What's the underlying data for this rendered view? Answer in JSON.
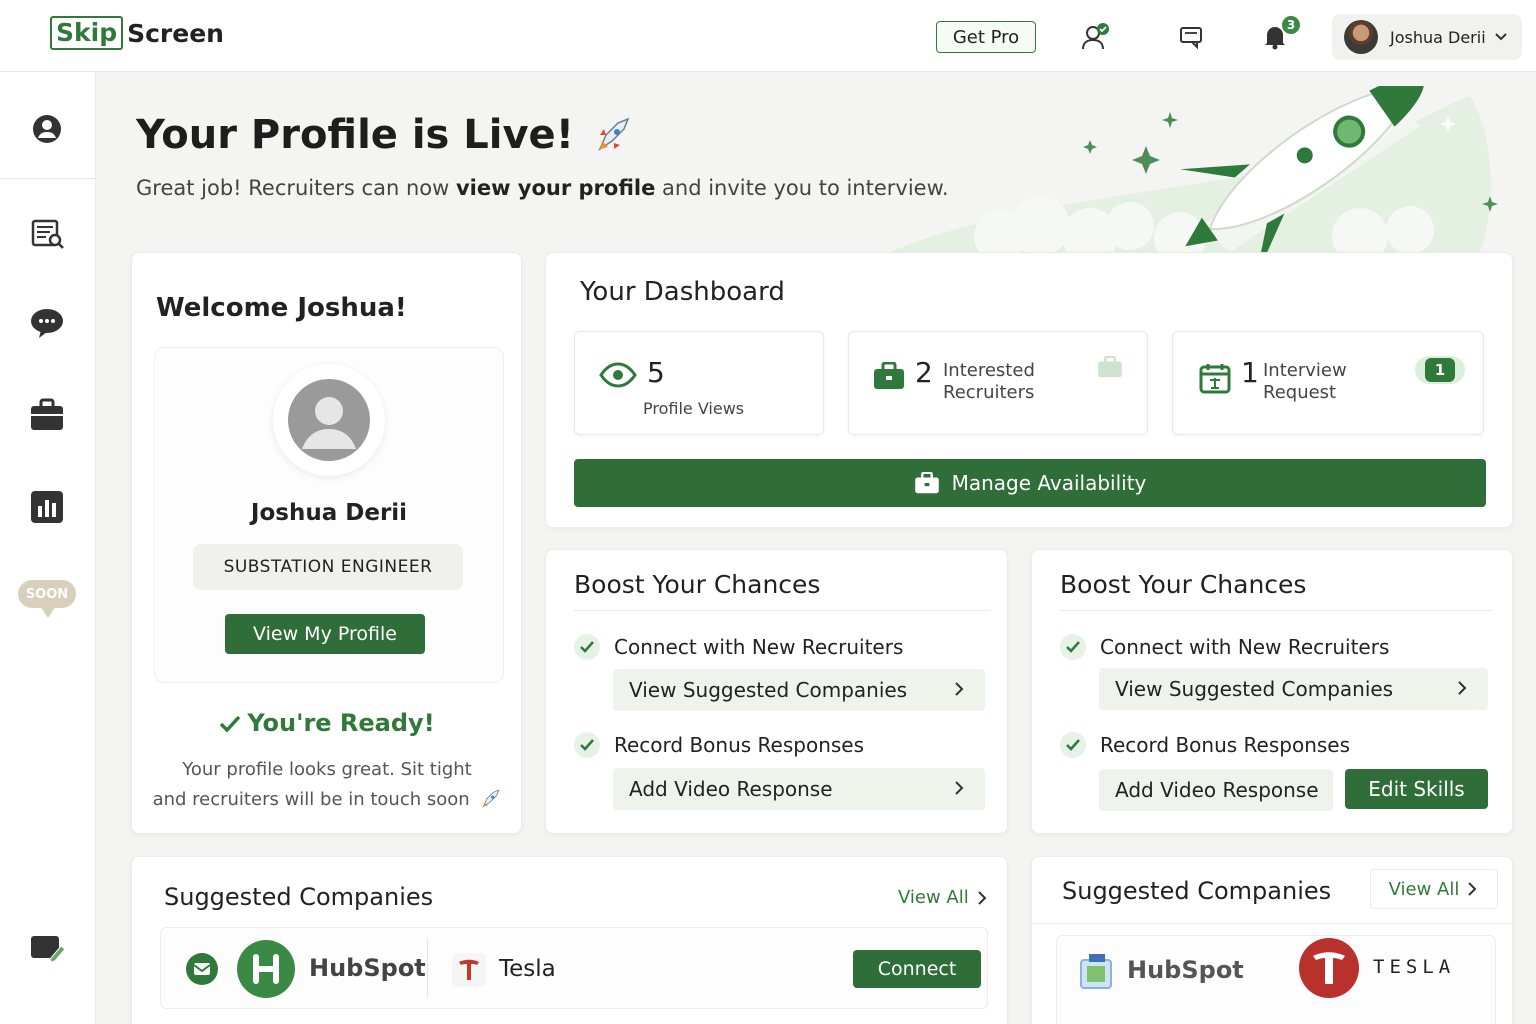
{
  "header": {
    "logo_part1": "Skip",
    "logo_part2": "Screen",
    "get_pro": "Get Pro",
    "notifications_count": "3",
    "user_name": "Joshua Derii"
  },
  "sidebar": {
    "items": [
      "profile-icon",
      "job-search-icon",
      "messages-icon",
      "briefcase-icon",
      "analytics-icon",
      "edit-icon"
    ],
    "soon_label": "SOON"
  },
  "hero": {
    "title": "Your Profile is Live!",
    "subtitle_pre": "Great job! Recruiters can now ",
    "subtitle_bold": "view your profile",
    "subtitle_post": " and invite you to interview."
  },
  "welcome": {
    "title": "Welcome Joshua!",
    "name": "Joshua Derii",
    "job_title": "SUBSTATION ENGINEER",
    "view_profile": "View My Profile",
    "ready_title": "You're Ready!",
    "ready_line1": "Your profile looks great. Sit tight",
    "ready_line2": "and recruiters will be in touch soon"
  },
  "dashboard": {
    "title": "Your Dashboard",
    "stats": [
      {
        "value": "5",
        "label": "Profile Views"
      },
      {
        "value": "2",
        "label_line1": "Interested",
        "label_line2": "Recruiters"
      },
      {
        "value": "1",
        "label_line1": "Interview",
        "label_line2": "Request",
        "badge": "1"
      }
    ],
    "manage_availability": "Manage Availability"
  },
  "boost_left": {
    "title": "Boost Your Chances",
    "item1": "Connect with New Recruiters",
    "action1": "View Suggested Companies",
    "item2": "Record Bonus Responses",
    "action2": "Add Video Response"
  },
  "boost_right": {
    "title": "Boost Your Chances",
    "item1": "Connect with New Recruiters",
    "action1": "View Suggested Companies",
    "item2": "Record Bonus Responses",
    "action2": "Add Video Response",
    "edit_skills": "Edit Skills"
  },
  "suggested_left": {
    "title": "Suggested Companies",
    "view_all": "View All",
    "company1": "HubSpot",
    "company2": "Tesla",
    "connect": "Connect"
  },
  "suggested_right": {
    "title": "Suggested Companies",
    "view_all": "View All",
    "company1": "HubSpot",
    "company2": "TESLA"
  },
  "colors": {
    "brand_green": "#2f6e39",
    "accent_green": "#2f7a3b",
    "light_green": "#eef4ec",
    "background": "#f4f4f3"
  }
}
